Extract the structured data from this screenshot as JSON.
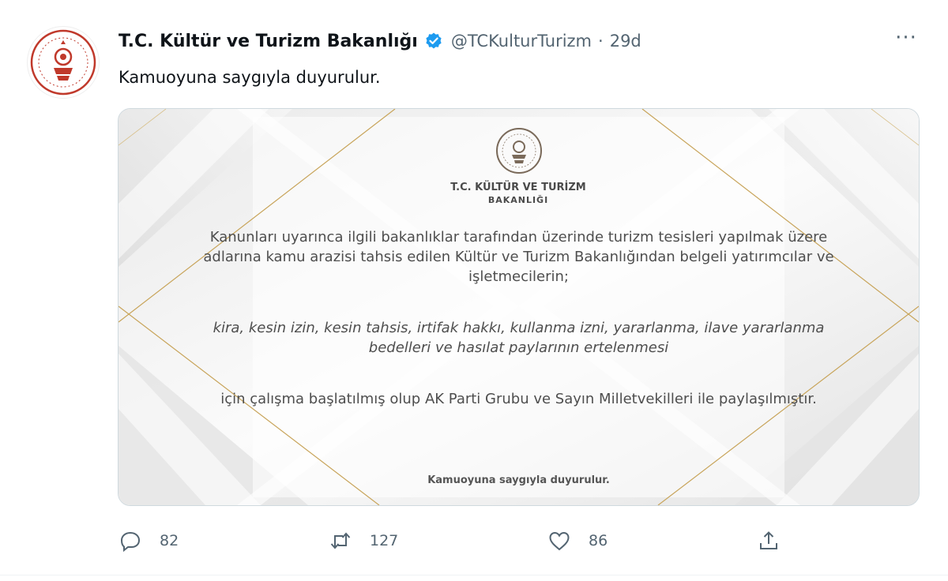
{
  "tweet": {
    "author_name": "T.C. Kültür ve Turizm Bakanlığı",
    "handle": "@TCKulturTurizm",
    "separator": "·",
    "time": "29d",
    "more_label": "···",
    "text": "Kamuoyuna saygıyla duyurulur."
  },
  "media": {
    "org_line1": "T.C. KÜLTÜR VE TURİZM",
    "org_line2": "BAKANLIĞI",
    "paragraph1": "Kanunları uyarınca ilgili bakanlıklar tarafından üzerinde turizm tesisleri yapılmak üzere adlarına kamu arazisi tahsis edilen Kültür ve Turizm Bakanlığından belgeli yatırımcılar ve işletmecilerin;",
    "paragraph2": "kira, kesin izin, kesin tahsis, irtifak hakkı, kullanma izni, yararlanma, ilave yararlanma bedelleri ve hasılat paylarının ertelenmesi",
    "paragraph3": "için çalışma başlatılmış olup AK Parti Grubu ve Sayın Milletvekilleri ile paylaşılmıştır.",
    "footer": "Kamuoyuna saygıyla duyurulur."
  },
  "actions": {
    "replies": "82",
    "retweets": "127",
    "likes": "86"
  },
  "colors": {
    "verified": "#1d9bf0",
    "muted": "#536471",
    "gold": "#c8a45a",
    "emblem_red": "#c0392b"
  },
  "icons": [
    "verified-badge-icon",
    "more-icon",
    "reply-icon",
    "retweet-icon",
    "like-icon",
    "share-icon"
  ]
}
